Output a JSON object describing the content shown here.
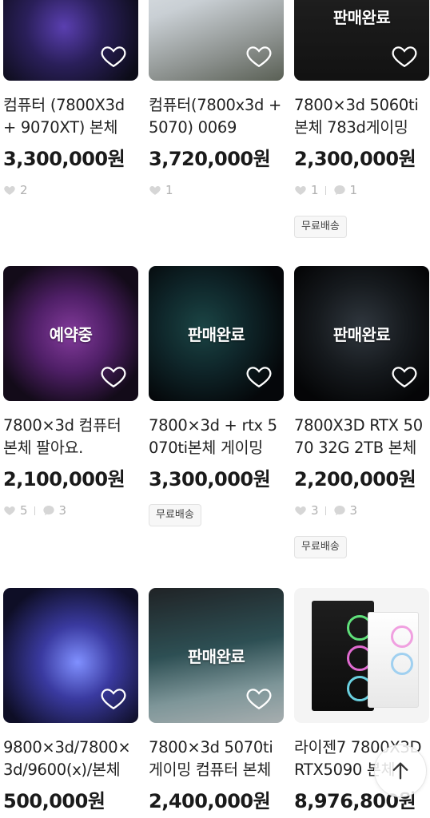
{
  "listings": [
    {
      "title": "컴퓨터 (7800X3d + 9070XT) 본체",
      "price": "3,300,000원",
      "status": "",
      "likes": "2",
      "chats": "",
      "badge": ""
    },
    {
      "title": "컴퓨터(7800x3d + 5070) 0069",
      "price": "3,720,000원",
      "status": "",
      "likes": "1",
      "chats": "",
      "badge": ""
    },
    {
      "title": "7800×3d 5060ti 본체 783d게이밍",
      "price": "2,300,000원",
      "status": "판매완료",
      "likes": "1",
      "chats": "1",
      "badge": "무료배송"
    },
    {
      "title": "7800×3d 컴퓨터 본체 팔아요.",
      "price": "2,100,000원",
      "status": "예약중",
      "likes": "5",
      "chats": "3",
      "badge": ""
    },
    {
      "title": "7800×3d + rtx 5070ti본체 게이밍",
      "price": "3,300,000원",
      "status": "판매완료",
      "likes": "",
      "chats": "",
      "badge": "무료배송"
    },
    {
      "title": "7800X3D RTX 5070 32G 2TB 본체",
      "price": "2,200,000원",
      "status": "판매완료",
      "likes": "3",
      "chats": "3",
      "badge": "무료배송"
    },
    {
      "title": "9800×3d/7800×3d/9600(x)/본체",
      "price": "500,000원",
      "status": "",
      "likes": "",
      "chats": "",
      "badge": ""
    },
    {
      "title": "7800×3d 5070ti 게이밍 컴퓨터 본체",
      "price": "2,400,000원",
      "status": "판매완료",
      "likes": "",
      "chats": "",
      "badge": ""
    },
    {
      "title": "라이젠7 7800X3D RTX5090 본체",
      "price": "8,976,800원",
      "status": "",
      "likes": "",
      "chats": "",
      "badge": ""
    }
  ],
  "scroll_top_icon": "arrow-up-icon",
  "colors": {
    "heart": "#ffffff",
    "stat": "#b0b0b0",
    "badge_bg": "#f7f7f7"
  }
}
